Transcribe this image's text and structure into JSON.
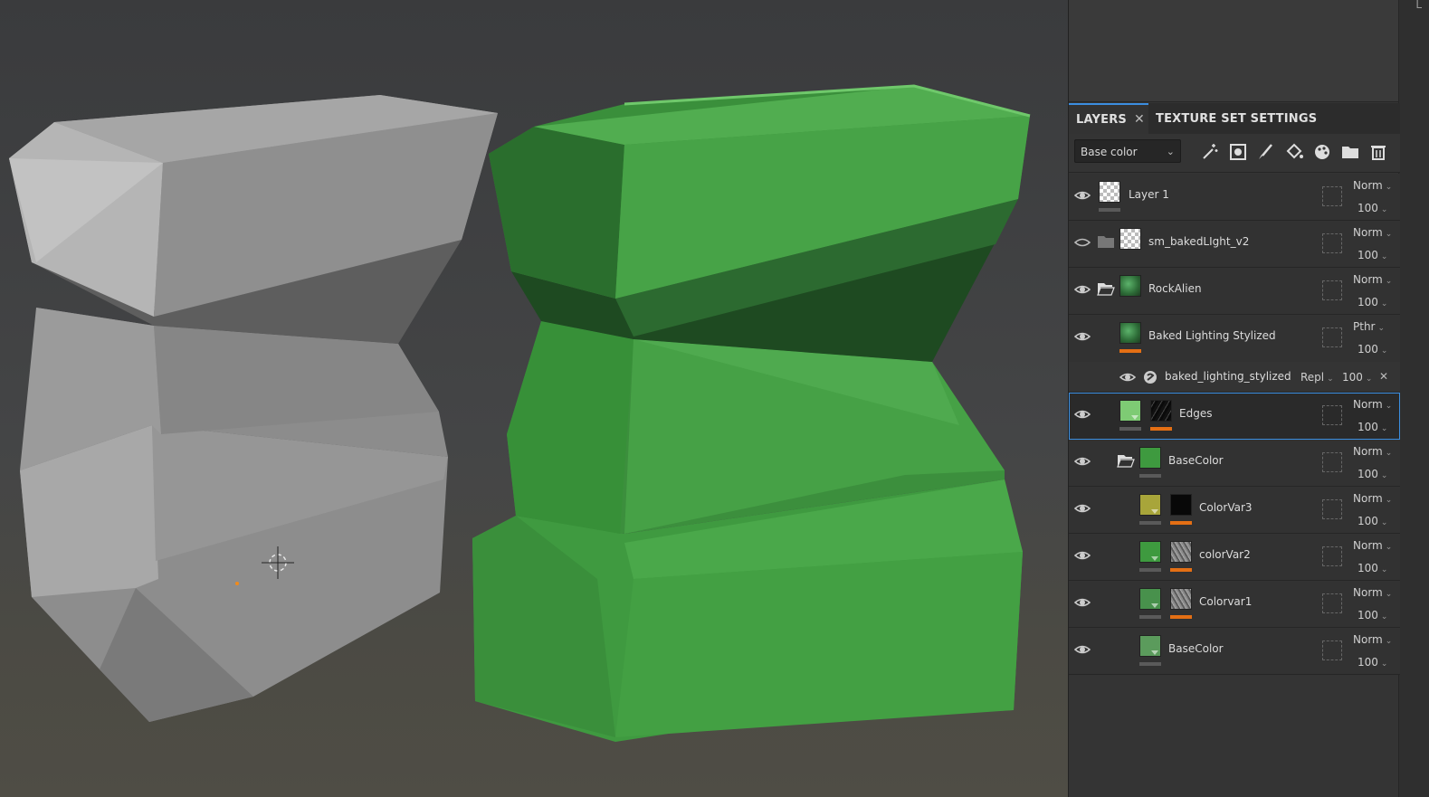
{
  "panel": {
    "corner_mark": "L",
    "tabs": [
      {
        "label": "LAYERS",
        "close": "✕",
        "active": true
      },
      {
        "label": "TEXTURE SET SETTINGS",
        "active": false
      }
    ],
    "channel_select": {
      "value": "Base color"
    },
    "toolbar_icons": [
      "magic-wand-icon",
      "mask-icon",
      "brush-icon",
      "fill-bucket-icon",
      "palette-icon",
      "folder-icon",
      "trash-icon"
    ]
  },
  "layers": [
    {
      "name": "Layer 1",
      "blend": "Norm",
      "opacity": "100",
      "visible": true
    },
    {
      "name": "sm_bakedLIght_v2",
      "blend": "Norm",
      "opacity": "100",
      "visible": false
    },
    {
      "name": "RockAlien",
      "blend": "Norm",
      "opacity": "100",
      "visible": true
    },
    {
      "name": "Baked Lighting Stylized",
      "blend": "Pthr",
      "opacity": "100",
      "visible": true
    },
    {
      "name": "baked_lighting_stylized",
      "blend": "Repl",
      "opacity": "100",
      "close": "✕"
    },
    {
      "name": "Edges",
      "blend": "Norm",
      "opacity": "100",
      "visible": true,
      "selected": true
    },
    {
      "name": "BaseColor",
      "blend": "Norm",
      "opacity": "100",
      "visible": true
    },
    {
      "name": "ColorVar3",
      "blend": "Norm",
      "opacity": "100",
      "visible": true
    },
    {
      "name": "colorVar2",
      "blend": "Norm",
      "opacity": "100",
      "visible": true
    },
    {
      "name": "Colorvar1",
      "blend": "Norm",
      "opacity": "100",
      "visible": true
    },
    {
      "name": "BaseColor",
      "blend": "Norm",
      "opacity": "100",
      "visible": true
    }
  ],
  "colors": {
    "accent": "#3b8ee0",
    "mask_bar": "#e46f14",
    "rock_green": "#3f9a40",
    "rock_grey": "#9a9a9a"
  }
}
